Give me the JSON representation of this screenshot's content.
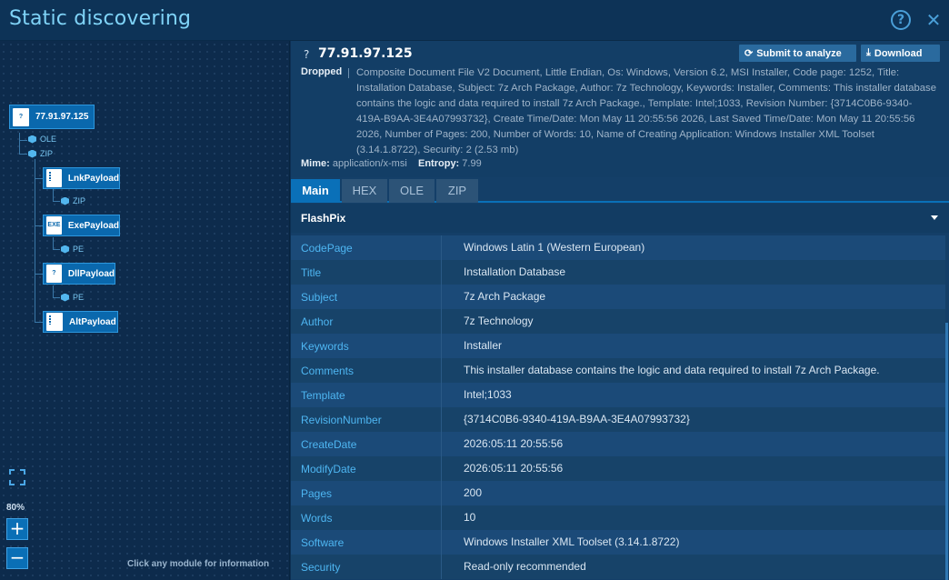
{
  "header": {
    "title": "Static discovering",
    "help_icon": "?",
    "close_icon": "✕"
  },
  "tree": {
    "root": {
      "label": "77.91.97.125",
      "icon": "?"
    },
    "root_children": [
      "OLE",
      "ZIP"
    ],
    "payloads": [
      {
        "label": "LnkPayload",
        "icon": "zip",
        "child": "ZIP"
      },
      {
        "label": "ExePayload",
        "icon": "EXE",
        "child": "PE"
      },
      {
        "label": "DllPayload",
        "icon": "?",
        "child": "PE"
      },
      {
        "label": "AltPayload",
        "icon": "zip",
        "child": ""
      }
    ],
    "zoom": "80%",
    "zoom_in": "+",
    "zoom_out": "−",
    "hint": "Click any module for information"
  },
  "info": {
    "question": "?",
    "ip": "77.91.97.125",
    "submit_label": "Submit to analyze",
    "download_label": "Download",
    "dropped_label": "Dropped",
    "dropped_text": "Composite Document File V2 Document, Little Endian, Os: Windows, Version 6.2, MSI Installer, Code page: 1252, Title: Installation Database, Subject: 7z Arch Package, Author: 7z Technology, Keywords: Installer, Comments: This installer database contains the logic and data required to install 7z Arch Package., Template: Intel;1033, Revision Number: {3714C0B6-9340-419A-B9AA-3E4A07993732}, Create Time/Date: Mon May 11 20:55:56 2026, Last Saved Time/Date: Mon May 11 20:55:56 2026, Number of Pages: 200, Number of Words: 10, Name of Creating Application: Windows Installer XML Toolset (3.14.1.8722), Security: 2 (2.53 mb)",
    "mime_label": "Mime:",
    "mime_value": "application/x-msi",
    "entropy_label": "Entropy:",
    "entropy_value": "7.99"
  },
  "tabs": [
    "Main",
    "HEX",
    "OLE",
    "ZIP"
  ],
  "section": {
    "title": "FlashPix"
  },
  "rows": [
    {
      "k": "CodePage",
      "v": "Windows Latin 1 (Western European)"
    },
    {
      "k": "Title",
      "v": "Installation Database"
    },
    {
      "k": "Subject",
      "v": "7z Arch Package"
    },
    {
      "k": "Author",
      "v": "7z Technology"
    },
    {
      "k": "Keywords",
      "v": "Installer"
    },
    {
      "k": "Comments",
      "v": "This installer database contains the logic and data required to install 7z Arch Package."
    },
    {
      "k": "Template",
      "v": "Intel;1033"
    },
    {
      "k": "RevisionNumber",
      "v": "{3714C0B6-9340-419A-B9AA-3E4A07993732}"
    },
    {
      "k": "CreateDate",
      "v": "2026:05:11 20:55:56"
    },
    {
      "k": "ModifyDate",
      "v": "2026:05:11 20:55:56"
    },
    {
      "k": "Pages",
      "v": "200"
    },
    {
      "k": "Words",
      "v": "10"
    },
    {
      "k": "Software",
      "v": "Windows Installer XML Toolset (3.14.1.8722)"
    },
    {
      "k": "Security",
      "v": "Read-only recommended"
    }
  ]
}
